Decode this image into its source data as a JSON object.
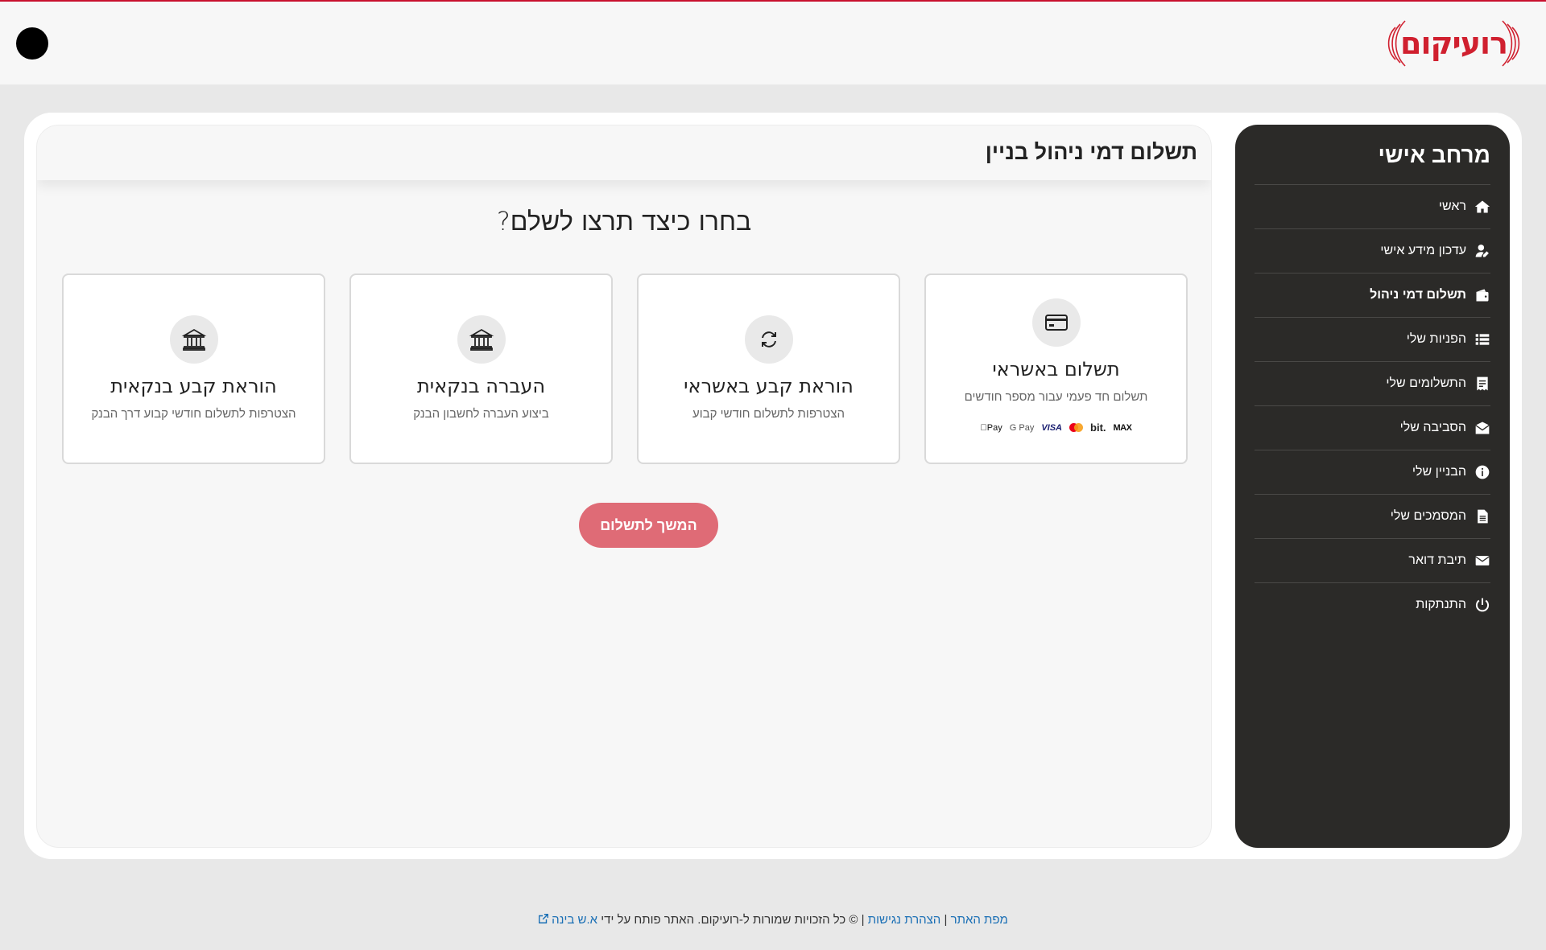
{
  "header": {
    "logo_text": "רועיקום",
    "accessibility_label": ""
  },
  "sidebar": {
    "title": "מרחב אישי",
    "items": [
      {
        "label": "ראשי",
        "icon": "home-icon",
        "active": false
      },
      {
        "label": "עדכון מידע אישי",
        "icon": "user-edit-icon",
        "active": false
      },
      {
        "label": "תשלום דמי ניהול",
        "icon": "wallet-icon",
        "active": true
      },
      {
        "label": "הפניות שלי",
        "icon": "list-icon",
        "active": false
      },
      {
        "label": "התשלומים שלי",
        "icon": "receipt-icon",
        "active": false
      },
      {
        "label": "הסביבה שלי",
        "icon": "map-icon",
        "active": false
      },
      {
        "label": "הבניין שלי",
        "icon": "info-icon",
        "active": false
      },
      {
        "label": "המסמכים שלי",
        "icon": "document-icon",
        "active": false
      },
      {
        "label": "תיבת דואר",
        "icon": "envelope-icon",
        "active": false
      },
      {
        "label": "התנתקות",
        "icon": "power-icon",
        "active": false
      }
    ]
  },
  "main": {
    "title": "תשלום דמי ניהול בניין",
    "question": "בחרו כיצד תרצו לשלם?",
    "options": [
      {
        "title": "תשלום באשראי",
        "subtitle": "תשלום חד פעמי עבור מספר חודשים",
        "icon": "credit-card-icon"
      },
      {
        "title": "הוראת קבע באשראי",
        "subtitle": "הצטרפות לתשלום חודשי קבוע",
        "icon": "sync-icon"
      },
      {
        "title": "העברה בנקאית",
        "subtitle": "ביצוע העברה לחשבון הבנק",
        "icon": "bank-icon"
      },
      {
        "title": "הוראת קבע בנקאית",
        "subtitle": "הצטרפות לתשלום חודשי קבוע דרך הבנק",
        "icon": "bank-icon"
      }
    ],
    "payment_logos": {
      "max": "MAX",
      "bit": "bit.",
      "visa": "VISA",
      "gpay": "G Pay",
      "apay": "Pay"
    },
    "continue_label": "המשך לתשלום"
  },
  "footer": {
    "sitemap": "מפת האתר",
    "accessibility": "הצהרת נגישות",
    "copyright": "© כל הזכויות שמורות ל-רועיקום. האתר פותח על ידי",
    "developer": "א.ש בינה",
    "separator": "|"
  },
  "colors": {
    "brand_red": "#d0202f",
    "sidebar_bg": "#2b2a28",
    "button": "#df6b76",
    "link": "#1a6fb5"
  }
}
